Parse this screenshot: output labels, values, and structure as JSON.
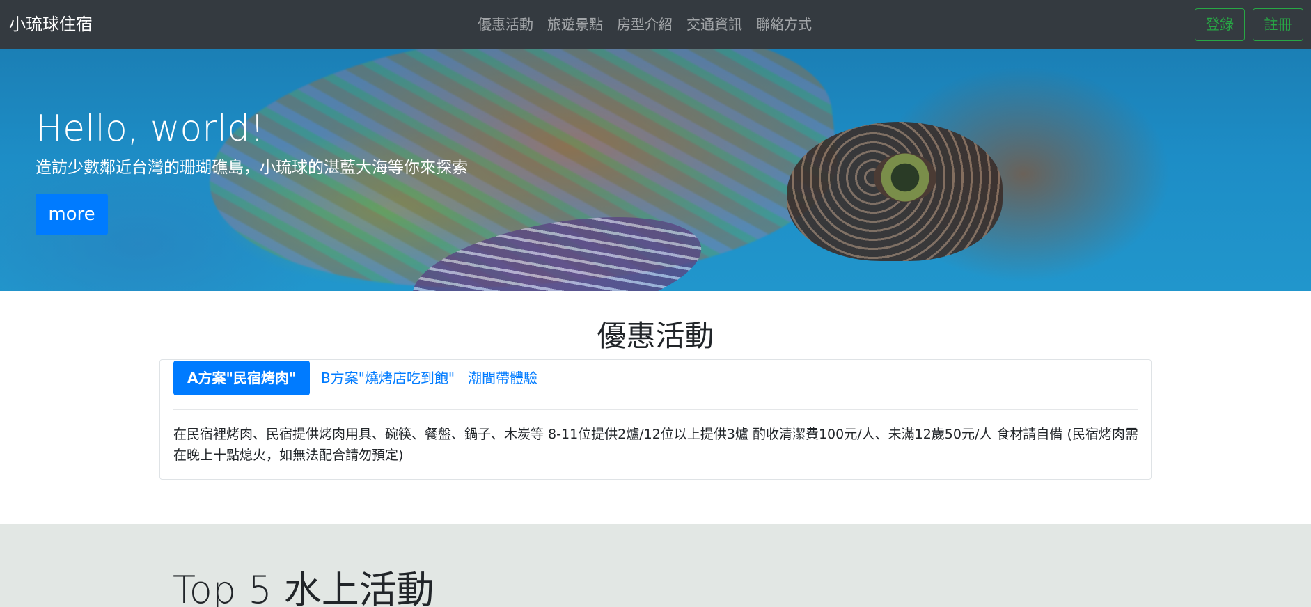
{
  "navbar": {
    "brand": "小琉球住宿",
    "links": [
      "優惠活動",
      "旅遊景點",
      "房型介紹",
      "交通資訊",
      "聯絡方式"
    ],
    "login_label": "登錄",
    "register_label": "註冊",
    "accent_color": "#28a745"
  },
  "hero": {
    "title": "Hello, world!",
    "subtitle": "造訪少數鄰近台灣的珊瑚礁島，小琉球的湛藍大海等你來探索",
    "button_label": "more",
    "button_color": "#007bff"
  },
  "promotions": {
    "title": "優惠活動",
    "tabs": [
      {
        "label": "A方案\"民宿烤肉\"",
        "active": true
      },
      {
        "label": "B方案\"燒烤店吃到飽\"",
        "active": false
      },
      {
        "label": "潮間帶體驗",
        "active": false
      }
    ],
    "content": "在民宿裡烤肉、民宿提供烤肉用具、碗筷、餐盤、鍋子、木炭等 8-11位提供2爐/12位以上提供3爐 酌收清潔費100元/人、未滿12歲50元/人 食材請自備 (民宿烤肉需在晚上十點熄火，如無法配合請勿預定)"
  },
  "activities": {
    "title": "Top 5 水上活動"
  }
}
